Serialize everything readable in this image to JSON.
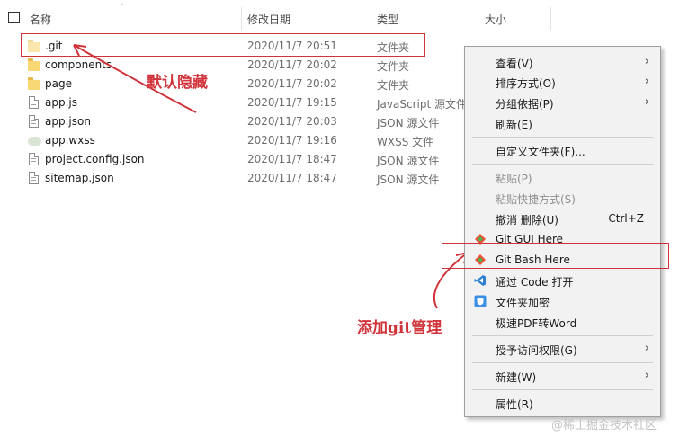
{
  "columns": {
    "name": "名称",
    "date": "修改日期",
    "type": "类型",
    "size": "大小"
  },
  "files": [
    {
      "name": ".git",
      "date": "2020/11/7 20:51",
      "type": "文件夹",
      "icon": "hidden-folder-icon"
    },
    {
      "name": "components",
      "date": "2020/11/7 20:02",
      "type": "文件夹",
      "icon": "folder-icon"
    },
    {
      "name": "page",
      "date": "2020/11/7 20:02",
      "type": "文件夹",
      "icon": "folder-icon"
    },
    {
      "name": "app.js",
      "date": "2020/11/7 19:15",
      "type": "JavaScript 源文件",
      "icon": "js-file-icon"
    },
    {
      "name": "app.json",
      "date": "2020/11/7 20:03",
      "type": "JSON 源文件",
      "icon": "json-file-icon"
    },
    {
      "name": "app.wxss",
      "date": "2020/11/7 19:16",
      "type": "WXSS 文件",
      "icon": "wxss-file-icon"
    },
    {
      "name": "project.config.json",
      "date": "2020/11/7 18:47",
      "type": "JSON 源文件",
      "icon": "json-file-icon"
    },
    {
      "name": "sitemap.json",
      "date": "2020/11/7 18:47",
      "type": "JSON 源文件",
      "icon": "json-file-icon"
    }
  ],
  "context_menu": {
    "view": "查看(V)",
    "sort": "排序方式(O)",
    "group": "分组依据(P)",
    "refresh": "刷新(E)",
    "customize": "自定义文件夹(F)...",
    "paste": "粘贴(P)",
    "paste_shortcut": "粘贴快捷方式(S)",
    "undo": "撤消 删除(U)",
    "undo_shortcut": "Ctrl+Z",
    "git_gui": "Git GUI Here",
    "git_bash": "Git Bash Here",
    "open_code": "通过 Code 打开",
    "encrypt": "文件夹加密",
    "pdf_word": "极速PDF转Word",
    "grant_access": "授予访问权限(G)",
    "new": "新建(W)",
    "properties": "属性(R)"
  },
  "annotations": {
    "hidden_by_default": "默认隐藏",
    "add_git": "添加git管理"
  },
  "watermark": "@稀土掘金技术社区",
  "colors": {
    "annotation_red": "#d0333a",
    "folder_yellow": "#f8d775",
    "vscode_blue": "#2f80d1",
    "git_red": "#f05033",
    "git_green": "#4caf50"
  }
}
